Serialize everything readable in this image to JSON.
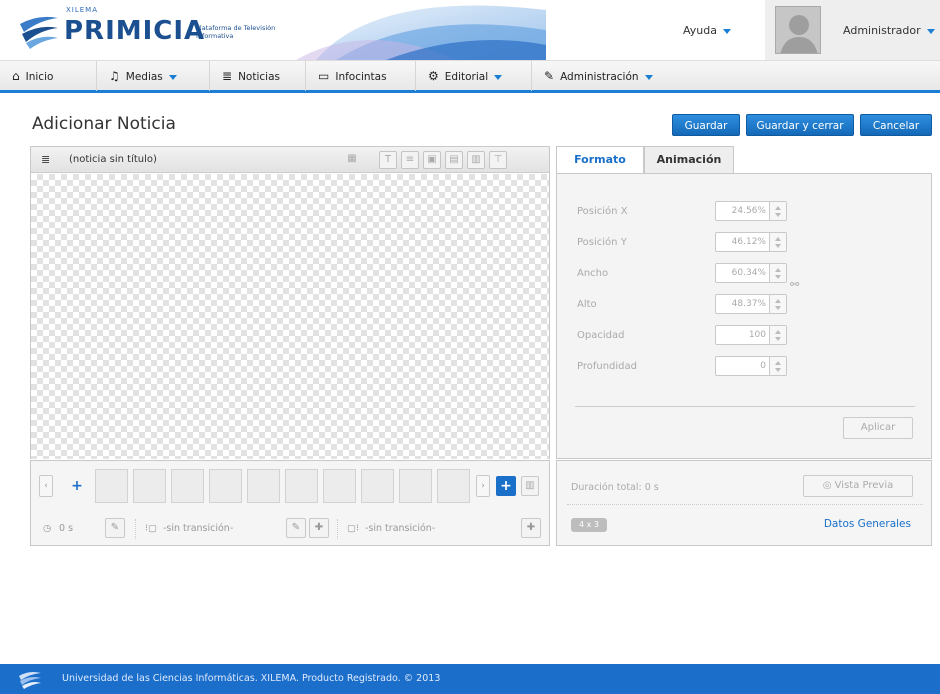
{
  "header": {
    "brand_small": "XILEMA",
    "brand": "PRIMICIA",
    "brand_sub": "Plataforma de Televisión Informativa",
    "help_label": "Ayuda",
    "user_name": "Administrador"
  },
  "nav": {
    "items": [
      {
        "label": "Inicio",
        "icon": "home-icon"
      },
      {
        "label": "Medias",
        "icon": "music-note-icon",
        "dropdown": true
      },
      {
        "label": "Noticias",
        "icon": "news-icon"
      },
      {
        "label": "Infocintas",
        "icon": "monitor-icon"
      },
      {
        "label": "Editorial",
        "icon": "gear-icon",
        "dropdown": true
      },
      {
        "label": "Administración",
        "icon": "wrench-icon",
        "dropdown": true
      }
    ]
  },
  "page": {
    "title": "Adicionar Noticia",
    "save_label": "Guardar",
    "save_close_label": "Guardar y cerrar",
    "cancel_label": "Cancelar"
  },
  "editor": {
    "title": "(noticia sin título)"
  },
  "timeline": {
    "duration": "0 s",
    "transition_in": "-sin transición-",
    "transition_out": "-sin transición-"
  },
  "props": {
    "tabs": [
      {
        "label": "Formato",
        "active": true
      },
      {
        "label": "Animación",
        "active": false
      }
    ],
    "fields": [
      {
        "label": "Posición X",
        "value": "24.56%"
      },
      {
        "label": "Posición Y",
        "value": "46.12%"
      },
      {
        "label": "Ancho",
        "value": "60.34%"
      },
      {
        "label": "Alto",
        "value": "48.37%"
      },
      {
        "label": "Opacidad",
        "value": "100"
      },
      {
        "label": "Profundidad",
        "value": "0"
      }
    ],
    "apply_label": "Aplicar"
  },
  "info": {
    "duration_total": "Duración total: 0 s",
    "preview_label": "Vista Previa",
    "aspect_badge": "4 x 3",
    "general_data_label": "Datos Generales"
  },
  "footer": {
    "text": "Universidad de las Ciencias Informáticas. XILEMA. Producto Registrado. © 2013"
  },
  "colors": {
    "accent": "#1a6fc9",
    "brand": "#1b4f8f",
    "footer": "#1b6fcb"
  }
}
